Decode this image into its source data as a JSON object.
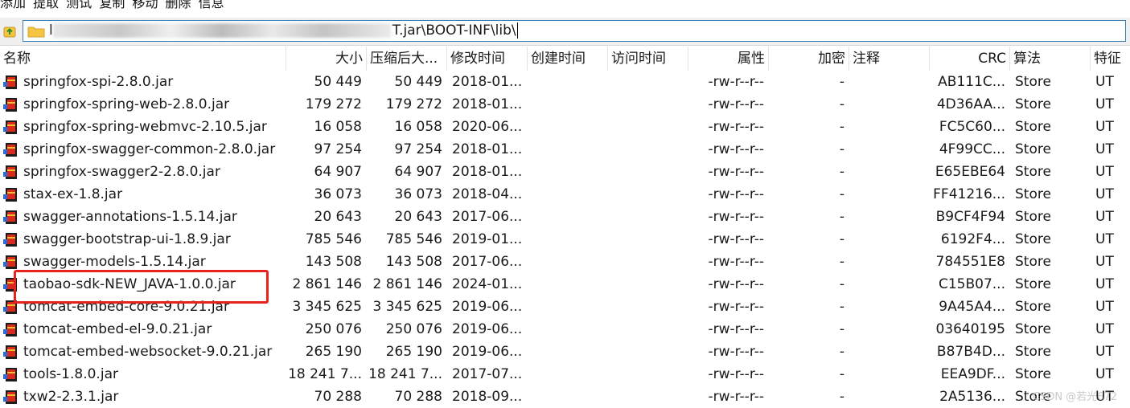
{
  "toolbar": {
    "items": [
      "添加",
      "提取",
      "测试",
      "复制",
      "移动",
      "删除",
      "信息"
    ]
  },
  "address": {
    "visible_suffix": "T.jar\\BOOT-INF\\lib\\"
  },
  "columns": [
    "名称",
    "大小",
    "压缩后大...",
    "修改时间",
    "创建时间",
    "访问时间",
    "属性",
    "加密",
    "注释",
    "CRC",
    "算法",
    "特征"
  ],
  "files": [
    {
      "name": "springfox-spi-2.8.0.jar",
      "size": "50 449",
      "packed": "50 449",
      "modified": "2018-01...",
      "attr": "-rw-r--r--",
      "enc": "-",
      "crc": "AB111C...",
      "method": "Store",
      "feature": "UT"
    },
    {
      "name": "springfox-spring-web-2.8.0.jar",
      "size": "179 272",
      "packed": "179 272",
      "modified": "2018-01...",
      "attr": "-rw-r--r--",
      "enc": "-",
      "crc": "4D36AA...",
      "method": "Store",
      "feature": "UT"
    },
    {
      "name": "springfox-spring-webmvc-2.10.5.jar",
      "size": "16 058",
      "packed": "16 058",
      "modified": "2020-06...",
      "attr": "-rw-r--r--",
      "enc": "-",
      "crc": "FC5C60...",
      "method": "Store",
      "feature": "UT"
    },
    {
      "name": "springfox-swagger-common-2.8.0.jar",
      "size": "97 254",
      "packed": "97 254",
      "modified": "2018-01...",
      "attr": "-rw-r--r--",
      "enc": "-",
      "crc": "4F99CC...",
      "method": "Store",
      "feature": "UT"
    },
    {
      "name": "springfox-swagger2-2.8.0.jar",
      "size": "64 907",
      "packed": "64 907",
      "modified": "2018-01...",
      "attr": "-rw-r--r--",
      "enc": "-",
      "crc": "E65EBE64",
      "method": "Store",
      "feature": "UT"
    },
    {
      "name": "stax-ex-1.8.jar",
      "size": "36 073",
      "packed": "36 073",
      "modified": "2018-04...",
      "attr": "-rw-r--r--",
      "enc": "-",
      "crc": "FF41216...",
      "method": "Store",
      "feature": "UT"
    },
    {
      "name": "swagger-annotations-1.5.14.jar",
      "size": "20 643",
      "packed": "20 643",
      "modified": "2017-06...",
      "attr": "-rw-r--r--",
      "enc": "-",
      "crc": "B9CF4F94",
      "method": "Store",
      "feature": "UT"
    },
    {
      "name": "swagger-bootstrap-ui-1.8.9.jar",
      "size": "785 546",
      "packed": "785 546",
      "modified": "2019-01...",
      "attr": "-rw-r--r--",
      "enc": "-",
      "crc": "6192F4...",
      "method": "Store",
      "feature": "UT"
    },
    {
      "name": "swagger-models-1.5.14.jar",
      "size": "143 508",
      "packed": "143 508",
      "modified": "2017-06...",
      "attr": "-rw-r--r--",
      "enc": "-",
      "crc": "784551E8",
      "method": "Store",
      "feature": "UT"
    },
    {
      "name": "taobao-sdk-NEW_JAVA-1.0.0.jar",
      "size": "2 861 146",
      "packed": "2 861 146",
      "modified": "2024-01...",
      "attr": "-rw-r--r--",
      "enc": "-",
      "crc": "C15B07...",
      "method": "Store",
      "feature": "UT"
    },
    {
      "name": "tomcat-embed-core-9.0.21.jar",
      "size": "3 345 625",
      "packed": "3 345 625",
      "modified": "2019-06...",
      "attr": "-rw-r--r--",
      "enc": "-",
      "crc": "9A45A4...",
      "method": "Store",
      "feature": "UT"
    },
    {
      "name": "tomcat-embed-el-9.0.21.jar",
      "size": "250 076",
      "packed": "250 076",
      "modified": "2019-06...",
      "attr": "-rw-r--r--",
      "enc": "-",
      "crc": "03640195",
      "method": "Store",
      "feature": "UT"
    },
    {
      "name": "tomcat-embed-websocket-9.0.21.jar",
      "size": "265 190",
      "packed": "265 190",
      "modified": "2019-06...",
      "attr": "-rw-r--r--",
      "enc": "-",
      "crc": "B87B4D...",
      "method": "Store",
      "feature": "UT"
    },
    {
      "name": "tools-1.8.0.jar",
      "size": "18 241 7...",
      "packed": "18 241 7...",
      "modified": "2017-07...",
      "attr": "-rw-r--r--",
      "enc": "-",
      "crc": "EEA9DF...",
      "method": "Store",
      "feature": "UT"
    },
    {
      "name": "txw2-2.3.1.jar",
      "size": "70 288",
      "packed": "70 288",
      "modified": "2018-09...",
      "attr": "-rw-r--r--",
      "enc": "-",
      "crc": "2A5136...",
      "method": "Store",
      "feature": "UT"
    }
  ],
  "highlight_file": "taobao-sdk-NEW_JAVA-1.0.0.jar",
  "watermark": "CSDN @若光672",
  "colors": {
    "highlight_border": "#e8231e",
    "address_border": "#3c7fb1",
    "jar_icon_red": "#d92a1c"
  }
}
